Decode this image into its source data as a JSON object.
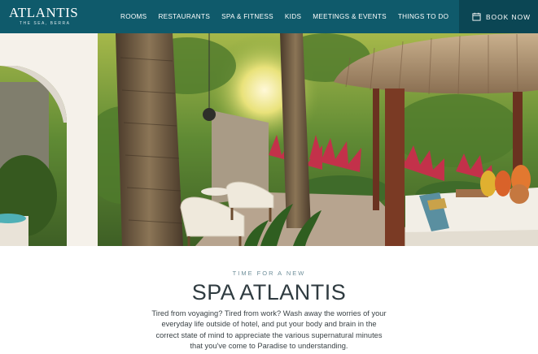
{
  "header": {
    "logo": {
      "name": "ATLANTIS",
      "tagline": "THE SEA, BERRA"
    },
    "nav": [
      {
        "label": "ROOMS"
      },
      {
        "label": "RESTAURANTS"
      },
      {
        "label": "SPA & FITNESS"
      },
      {
        "label": "KIDS"
      },
      {
        "label": "MEETINGS & EVENTS"
      },
      {
        "label": "THINGS TO DO"
      }
    ],
    "book_now": {
      "label": "BOOK NOW",
      "icon": "calendar-icon"
    }
  },
  "hero": {
    "scene": "tropical-spa-courtyard",
    "colors": {
      "header_bg": "#0f5a6b",
      "book_bg": "#0b4654"
    }
  },
  "content": {
    "kicker": "TIME FOR A NEW",
    "title": "SPA ATLANTIS",
    "body": "Tired from voyaging? Tired from work? Wash away the worries of your everyday life outside of hotel, and put your body and brain in the correct state of mind to appreciate the various supernatural minutes that you've come to Paradise to understanding."
  }
}
